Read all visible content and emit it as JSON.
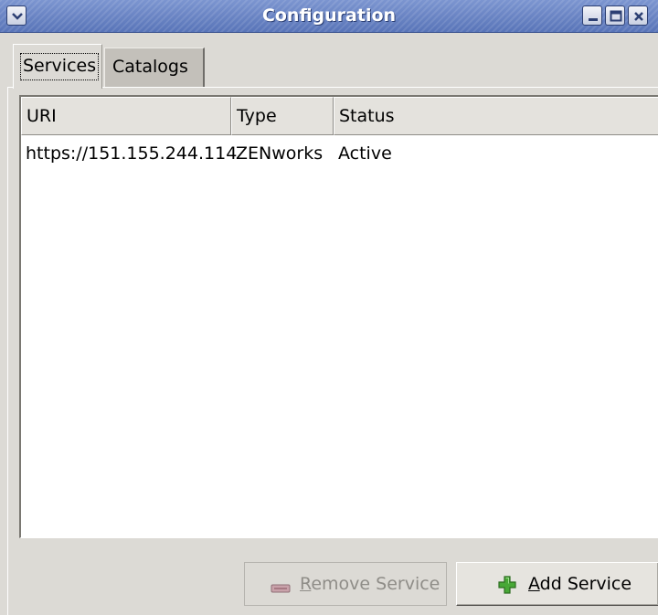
{
  "window": {
    "title": "Configuration"
  },
  "tabs": [
    {
      "label": "Services",
      "selected": true
    },
    {
      "label": "Catalogs",
      "selected": false
    }
  ],
  "services_table": {
    "columns": [
      "URI",
      "Type",
      "Status"
    ],
    "rows": [
      {
        "uri": "https://151.155.244.114",
        "type": "ZENworks",
        "status": "Active"
      }
    ]
  },
  "buttons": {
    "remove": {
      "mnemonic": "R",
      "rest": "emove Service",
      "enabled": false,
      "icon": "remove-icon"
    },
    "add": {
      "mnemonic": "A",
      "rest": "dd Service",
      "enabled": true,
      "icon": "add-plus-icon"
    }
  },
  "colors": {
    "titlebar": "#5874b8",
    "window_bg": "#dcdad5",
    "add_icon_green": "#3e9a2e",
    "remove_icon_red": "#b3465a"
  }
}
